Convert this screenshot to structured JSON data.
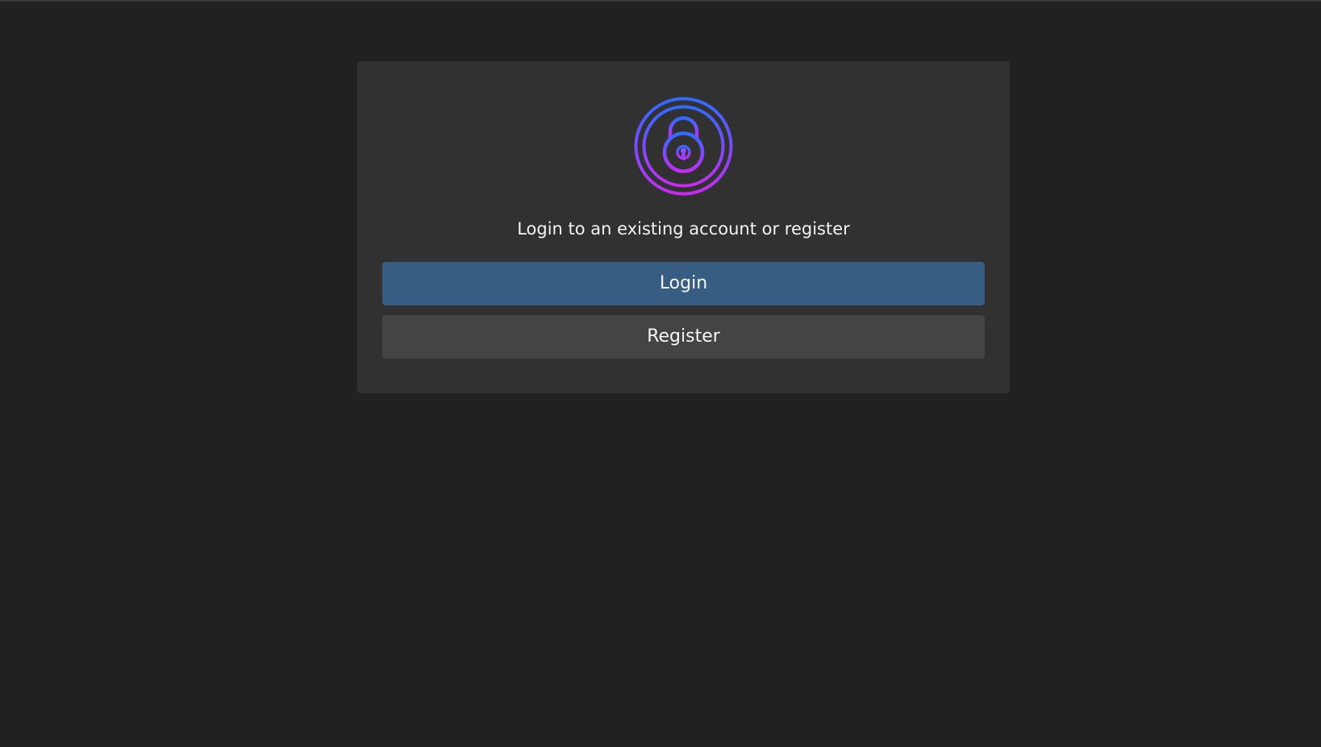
{
  "auth": {
    "prompt": "Login to an existing account or register",
    "login_label": "Login",
    "register_label": "Register",
    "logo_icon": "padlock-icon"
  },
  "colors": {
    "page_background": "#212121",
    "card_background": "#313131",
    "login_button": "#385d82",
    "register_button": "#444444",
    "logo_gradient_start": "#2f6bff",
    "logo_gradient_end": "#c42cf0"
  }
}
